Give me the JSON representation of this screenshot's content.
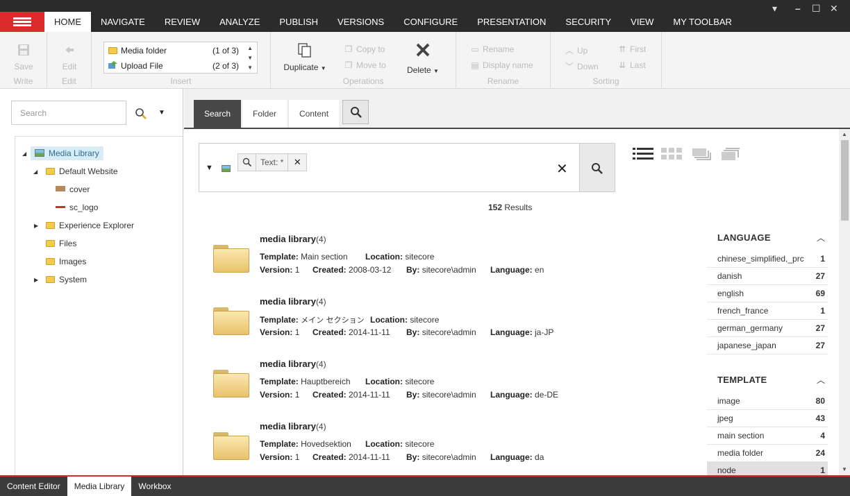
{
  "ribbon_tabs": [
    "HOME",
    "NAVIGATE",
    "REVIEW",
    "ANALYZE",
    "PUBLISH",
    "VERSIONS",
    "CONFIGURE",
    "PRESENTATION",
    "SECURITY",
    "VIEW",
    "MY TOOLBAR"
  ],
  "active_ribbon_tab": "HOME",
  "window_controls": {
    "min": "▾",
    "minimize": "–",
    "maximize": "☐",
    "close": "✕"
  },
  "ribbon": {
    "write": {
      "save": "Save",
      "label": "Write"
    },
    "edit": {
      "edit": "Edit",
      "label": "Edit"
    },
    "insert": {
      "items": [
        {
          "label": "Media folder",
          "count": "(1 of 3)"
        },
        {
          "label": "Upload File",
          "count": "(2 of 3)"
        }
      ],
      "label": "Insert"
    },
    "operations": {
      "duplicate": "Duplicate",
      "copy_to": "Copy to",
      "move_to": "Move to",
      "delete": "Delete",
      "label": "Operations"
    },
    "rename": {
      "rename": "Rename",
      "display_name": "Display name",
      "label": "Rename"
    },
    "sorting": {
      "up": "Up",
      "down": "Down",
      "first": "First",
      "last": "Last",
      "label": "Sorting"
    }
  },
  "left": {
    "search_placeholder": "Search",
    "tree": {
      "root": "Media Library",
      "default_website": "Default Website",
      "cover": "cover",
      "sc_logo": "sc_logo",
      "experience_explorer": "Experience Explorer",
      "files": "Files",
      "images": "Images",
      "system": "System"
    }
  },
  "main": {
    "tabs": [
      "Search",
      "Folder",
      "Content"
    ],
    "chip_text": "Text:  *",
    "results_count": "152",
    "results_label": "Results",
    "labels": {
      "template": "Template:",
      "location": "Location:",
      "version": "Version:",
      "created": "Created:",
      "by": "By:",
      "language": "Language:"
    },
    "results": [
      {
        "title": "media library",
        "count": "(4)",
        "template": "Main section",
        "location": "sitecore",
        "version": "1",
        "created": "2008-03-12",
        "by": "sitecore\\admin",
        "language": "en"
      },
      {
        "title": "media library",
        "count": "(4)",
        "template": "メイン セクション",
        "location": "sitecore",
        "version": "1",
        "created": "2014-11-11",
        "by": "sitecore\\admin",
        "language": "ja-JP"
      },
      {
        "title": "media library",
        "count": "(4)",
        "template": "Hauptbereich",
        "location": "sitecore",
        "version": "1",
        "created": "2014-11-11",
        "by": "sitecore\\admin",
        "language": "de-DE"
      },
      {
        "title": "media library",
        "count": "(4)",
        "template": "Hovedsektion",
        "location": "sitecore",
        "version": "1",
        "created": "2014-11-11",
        "by": "sitecore\\admin",
        "language": "da"
      }
    ],
    "facets": {
      "language": {
        "title": "LANGUAGE",
        "rows": [
          {
            "name": "chinese_simplified,_prc",
            "count": "1"
          },
          {
            "name": "danish",
            "count": "27"
          },
          {
            "name": "english",
            "count": "69"
          },
          {
            "name": "french_france",
            "count": "1"
          },
          {
            "name": "german_germany",
            "count": "27"
          },
          {
            "name": "japanese_japan",
            "count": "27"
          }
        ]
      },
      "template": {
        "title": "TEMPLATE",
        "rows": [
          {
            "name": "image",
            "count": "80"
          },
          {
            "name": "jpeg",
            "count": "43"
          },
          {
            "name": "main section",
            "count": "4"
          },
          {
            "name": "media folder",
            "count": "24"
          },
          {
            "name": "node",
            "count": "1"
          }
        ]
      }
    }
  },
  "bottom_tabs": [
    "Content Editor",
    "Media Library",
    "Workbox"
  ],
  "colors": {
    "accent": "#dc2a2a",
    "topbar": "#2b2b2b",
    "active_tab": "#474747"
  }
}
